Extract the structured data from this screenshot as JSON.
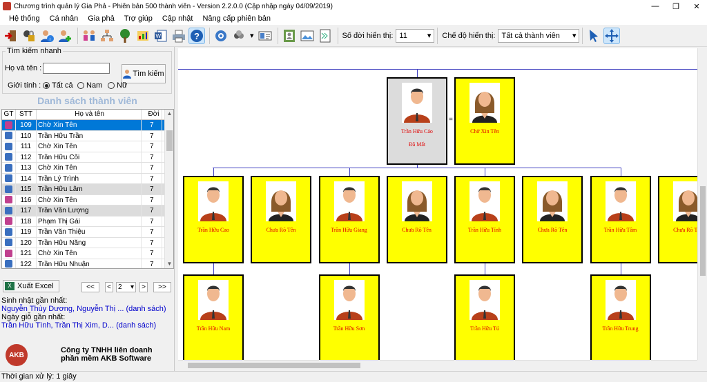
{
  "window": {
    "title": "Chương trình quản lý Gia Phả - Phiên bản 500 thành viên - Version 2.2.0.0 (Cập nhập ngày 04/09/2019)",
    "minimize": "—",
    "maximize": "❐",
    "close": "✕"
  },
  "menu": [
    "Hệ thống",
    "Cá nhân",
    "Gia phả",
    "Trợ giúp",
    "Cập nhật",
    "Nâng cấp phiên bản"
  ],
  "toolbar": {
    "generations_label": "Số đời hiển thị:",
    "generations_value": "11",
    "mode_label": "Chế độ hiển thị:",
    "mode_value": "Tất cả thành viên"
  },
  "quick_search": {
    "title": "Tìm kiếm nhanh",
    "name_label": "Họ và tên :",
    "name_value": "",
    "search_button": "Tìm kiếm",
    "gender_label": "Giới tính :",
    "gender_options": [
      "Tất cả",
      "Nam",
      "Nữ"
    ],
    "gender_selected": "Tất cả"
  },
  "member_list": {
    "title": "Danh sách thành viên",
    "headers": [
      "GT",
      "STT",
      "Họ và tên",
      "Đời"
    ],
    "rows": [
      {
        "gender": "f",
        "stt": "109",
        "name": "Chờ Xin Tên",
        "gen": "7"
      },
      {
        "gender": "m",
        "stt": "110",
        "name": "Trần Hữu Trần",
        "gen": "7"
      },
      {
        "gender": "m",
        "stt": "111",
        "name": "Chờ Xin Tên",
        "gen": "7"
      },
      {
        "gender": "m",
        "stt": "112",
        "name": "Trần Hữu Cõi",
        "gen": "7"
      },
      {
        "gender": "m",
        "stt": "113",
        "name": "Chờ Xin Tên",
        "gen": "7"
      },
      {
        "gender": "m",
        "stt": "114",
        "name": "Trần Lý Trình",
        "gen": "7"
      },
      {
        "gender": "m",
        "stt": "115",
        "name": "Trần Hữu Lâm",
        "gen": "7"
      },
      {
        "gender": "f",
        "stt": "116",
        "name": "Chờ Xin Tên",
        "gen": "7"
      },
      {
        "gender": "m",
        "stt": "117",
        "name": "Trần Văn Lượng",
        "gen": "7"
      },
      {
        "gender": "f",
        "stt": "118",
        "name": "Phạm Thị Gái",
        "gen": "7"
      },
      {
        "gender": "m",
        "stt": "119",
        "name": "Trần Văn Thiệu",
        "gen": "7"
      },
      {
        "gender": "m",
        "stt": "120",
        "name": "Trần Hữu Năng",
        "gen": "7"
      },
      {
        "gender": "f",
        "stt": "121",
        "name": "Chờ Xin Tên",
        "gen": "7"
      },
      {
        "gender": "m",
        "stt": "122",
        "name": "Trần Hữu Nhuận",
        "gen": "7"
      }
    ],
    "selected_index": 0
  },
  "export_button": "Xuất Excel",
  "pager": {
    "first": "<<",
    "prev": "<",
    "page": "2",
    "next": ">",
    "last": ">>"
  },
  "birthday": {
    "label": "Sinh nhật gần nhất:",
    "value": "Nguyễn Thùy Dương, Nguyễn Thị ... (danh sách)"
  },
  "anniversary": {
    "label": "Ngày giỗ gần nhất:",
    "value": "Trần Hữu Tình, Trần Thị Xim, D... (danh sách)"
  },
  "company": {
    "logo": "AKB",
    "line1": "Công ty TNHH liên doanh",
    "line2": "phần mềm AKB Software"
  },
  "status": "Thời gian xử lý: 1 giây",
  "tree": {
    "root": {
      "name": "Trần Hữu Cảo",
      "status": "Đã Mất",
      "gender": "m"
    },
    "root_spouse": {
      "name": "Chờ Xin Tên",
      "gender": "f"
    },
    "children": [
      {
        "name": "Trần Hữu Cao",
        "gender": "m",
        "spouse": "Chưa Rõ Tên",
        "child": "Trần Hữu Nam"
      },
      {
        "name": "Trần Hữu Giang",
        "gender": "m",
        "spouse": "Chưa Rõ Tên",
        "child": "Trần Hữu Sơn"
      },
      {
        "name": "Trần Hữu Tỉnh",
        "gender": "m",
        "spouse": "Chưa Rõ Tên",
        "child": "Trần Hữu Tú"
      },
      {
        "name": "Trần Hữu Tâm",
        "gender": "m",
        "spouse": "Chưa Rõ Tên",
        "child": "Trần Hữu Trung"
      }
    ],
    "card_color": "#ffff00",
    "deceased_color": "#dcdcdc",
    "name_color": "#e00000"
  }
}
